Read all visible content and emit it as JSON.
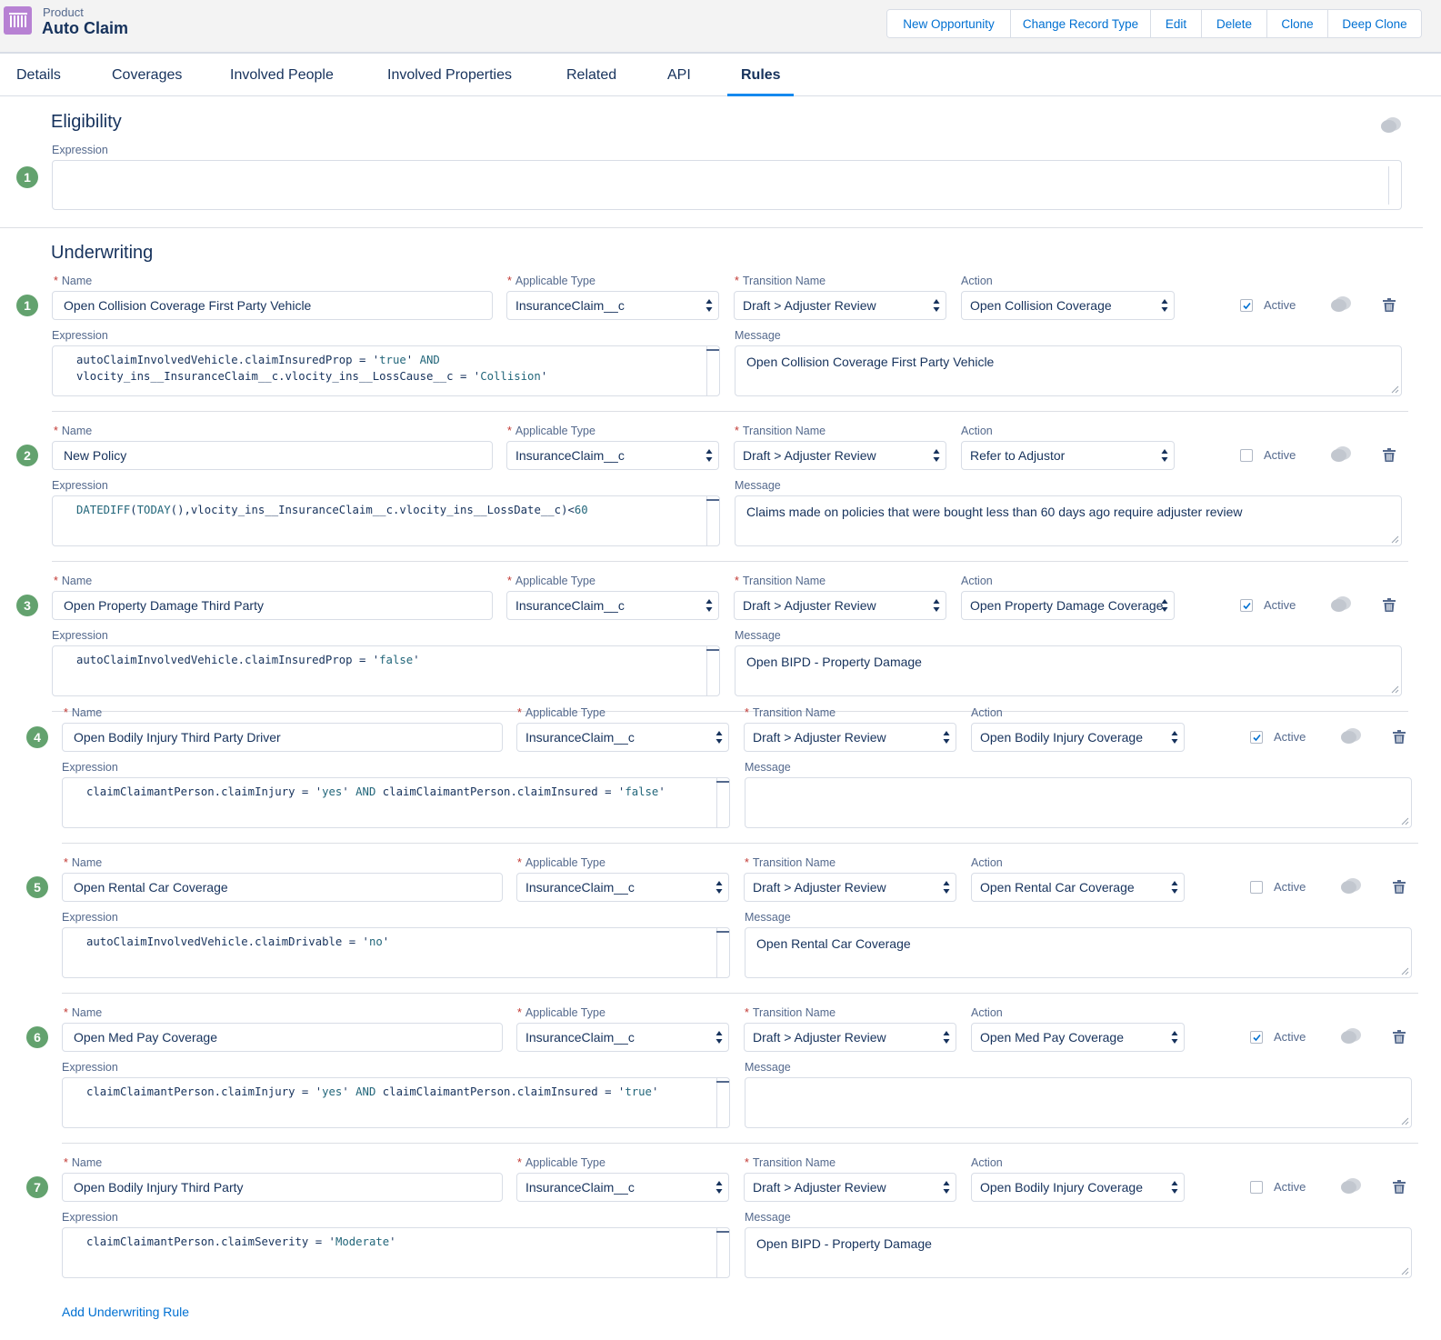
{
  "header": {
    "object_type": "Product",
    "title": "Auto Claim",
    "buttons": [
      "New Opportunity",
      "Change Record Type",
      "Edit",
      "Delete",
      "Clone",
      "Deep Clone"
    ]
  },
  "tabs": [
    "Details",
    "Coverages",
    "Involved People",
    "Involved Properties",
    "Related",
    "API",
    "Rules"
  ],
  "active_tab": "Rules",
  "eligibility": {
    "title": "Eligibility",
    "expression_label": "Expression",
    "number": "1",
    "expression": ""
  },
  "underwriting": {
    "title": "Underwriting",
    "labels": {
      "name": "Name",
      "applicable_type": "Applicable Type",
      "transition_name": "Transition Name",
      "action": "Action",
      "expression": "Expression",
      "message": "Message",
      "active": "Active",
      "required_marker": "*"
    },
    "rules": [
      {
        "number": "1",
        "name": "Open Collision Coverage First Party Vehicle",
        "applicable_type": "InsuranceClaim__c",
        "transition_name": "Draft > Adjuster Review",
        "action": "Open Collision Coverage",
        "active": true,
        "expression_lines": [
          "autoClaimInvolvedVehicle.claimInsuredProp = 'true' AND",
          "vlocity_ins__InsuranceClaim__c.vlocity_ins__LossCause__c = 'Collision'"
        ],
        "message": "Open Collision Coverage First Party Vehicle"
      },
      {
        "number": "2",
        "name": "New Policy",
        "applicable_type": "InsuranceClaim__c",
        "transition_name": "Draft > Adjuster Review",
        "action": "Refer to Adjustor",
        "active": false,
        "expression_lines": [
          "DATEDIFF(TODAY(),vlocity_ins__InsuranceClaim__c.vlocity_ins__LossDate__c)<60"
        ],
        "message": "Claims made on policies that were bought less than 60 days ago require adjuster review"
      },
      {
        "number": "3",
        "name": "Open Property Damage Third Party",
        "applicable_type": "InsuranceClaim__c",
        "transition_name": "Draft > Adjuster Review",
        "action": "Open Property Damage Coverage",
        "active": true,
        "expression_lines": [
          "autoClaimInvolvedVehicle.claimInsuredProp = 'false'"
        ],
        "message": "Open BIPD - Property Damage"
      },
      {
        "number": "4",
        "name": "Open Bodily Injury Third Party Driver",
        "applicable_type": "InsuranceClaim__c",
        "transition_name": "Draft > Adjuster Review",
        "action": "Open Bodily Injury Coverage",
        "active": true,
        "expression_lines": [
          "claimClaimantPerson.claimInjury = 'yes' AND claimClaimantPerson.claimInsured = 'false'"
        ],
        "message": ""
      },
      {
        "number": "5",
        "name": "Open Rental Car Coverage",
        "applicable_type": "InsuranceClaim__c",
        "transition_name": "Draft > Adjuster Review",
        "action": "Open Rental Car Coverage",
        "active": false,
        "expression_lines": [
          "autoClaimInvolvedVehicle.claimDrivable = 'no'"
        ],
        "message": "Open Rental Car Coverage"
      },
      {
        "number": "6",
        "name": "Open Med Pay Coverage",
        "applicable_type": "InsuranceClaim__c",
        "transition_name": "Draft > Adjuster Review",
        "action": "Open Med Pay Coverage",
        "active": true,
        "expression_lines": [
          "claimClaimantPerson.claimInjury = 'yes' AND claimClaimantPerson.claimInsured = 'true'"
        ],
        "message": ""
      },
      {
        "number": "7",
        "name": "Open Bodily Injury Third Party",
        "applicable_type": "InsuranceClaim__c",
        "transition_name": "Draft > Adjuster Review",
        "action": "Open Bodily Injury Coverage",
        "active": false,
        "expression_lines": [
          "claimClaimantPerson.claimSeverity = 'Moderate'"
        ],
        "message": "Open BIPD - Property Damage"
      }
    ],
    "add_rule_label": "Add Underwriting Rule"
  },
  "colors": {
    "link": "#0070d2",
    "text": "#16325c",
    "label": "#54698d",
    "number_badge": "#63a26e",
    "required": "#c23934",
    "tab_underline": "#1589ee",
    "product_icon": "#b781d3"
  }
}
